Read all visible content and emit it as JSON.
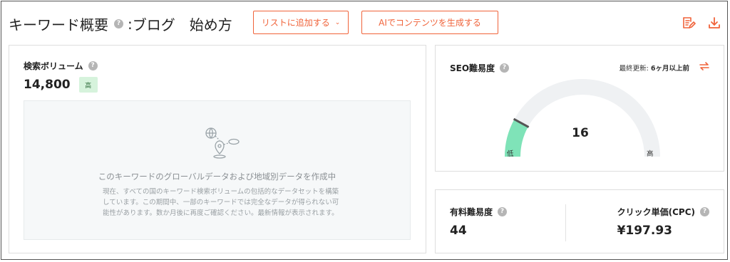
{
  "header": {
    "title": "キーワード概要",
    "separator": ":",
    "keyword": "ブログ　始め方",
    "add_to_list_label": "リストに追加する",
    "ai_generate_label": "AIでコンテンツを生成する",
    "icons": [
      "edit-note-icon",
      "download-icon"
    ]
  },
  "volume": {
    "label": "検索ボリューム",
    "value": "14,800",
    "badge": "高",
    "placeholder_title": "このキーワードのグローバルデータおよび地域別データを作成中",
    "placeholder_desc": "現在、すべての国のキーワード検索ボリュームの包括的なデータセットを構築しています。この期間中、一部のキーワードでは完全なデータが得られない可能性があります。数か月後に再度ご確認ください。最新情報が表示されます。"
  },
  "seo": {
    "label": "SEO難易度",
    "updated_prefix": "最終更新: ",
    "updated_value": "6ヶ月以上前",
    "value": "16",
    "gauge_fraction": 0.16,
    "low_label": "低",
    "high_label": "高"
  },
  "paid": {
    "label": "有料難易度",
    "value": "44"
  },
  "cpc": {
    "label": "クリック単価(CPC)",
    "value": "¥197.93"
  },
  "colors": {
    "accent": "#f0633a",
    "gauge_fill": "#7fe3b8",
    "gauge_track": "#eff1f3",
    "badge_bg": "#d6f3dc"
  }
}
